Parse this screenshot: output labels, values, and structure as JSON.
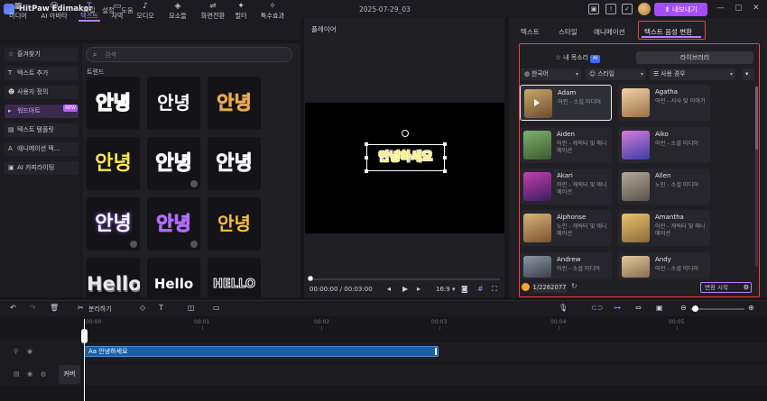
{
  "titlebar": {
    "app_name": "HitPaw Edimakor",
    "menus": [
      "파일",
      "설정",
      "도움"
    ],
    "document_title": "2025-07-29_03",
    "export_label": "내보내기"
  },
  "media_tabs": [
    {
      "label": "미디어",
      "icon": "media-icon"
    },
    {
      "label": "AI 아바타",
      "icon": "ai-avatar-icon"
    },
    {
      "label": "텍스트",
      "icon": "text-icon",
      "active": true
    },
    {
      "label": "자막",
      "icon": "subtitle-icon"
    },
    {
      "label": "오디오",
      "icon": "audio-icon"
    },
    {
      "label": "요소들",
      "icon": "elements-icon"
    },
    {
      "label": "화면전환",
      "icon": "transition-icon"
    },
    {
      "label": "필터",
      "icon": "filter-icon"
    },
    {
      "label": "특수효과",
      "icon": "effects-icon"
    }
  ],
  "sidebar": {
    "items": [
      {
        "label": "즐겨찾기",
        "icon": "star-icon"
      },
      {
        "label": "텍스트 추가",
        "icon": "text-add-icon"
      },
      {
        "label": "사용자 정의",
        "icon": "user-icon"
      },
      {
        "label": "워드아트",
        "icon": "wordart-icon",
        "badge": "NEW",
        "active": true
      },
      {
        "label": "텍스트 템플릿",
        "icon": "template-icon"
      },
      {
        "label": "애니메이션 텍...",
        "icon": "animation-text-icon"
      },
      {
        "label": "AI 카피라이팅",
        "icon": "ai-copy-icon"
      }
    ]
  },
  "text_panel": {
    "search_placeholder": "검색",
    "section_label": "트렌드",
    "tiles": [
      {
        "text": "안녕"
      },
      {
        "text": "안녕"
      },
      {
        "text": "안녕"
      },
      {
        "text": "안녕"
      },
      {
        "text": "안녕"
      },
      {
        "text": "안녕"
      },
      {
        "text": "안녕"
      },
      {
        "text": "안녕"
      },
      {
        "text": "안녕"
      },
      {
        "text": "Hello"
      },
      {
        "text": "Hello"
      },
      {
        "text": "HELLO"
      }
    ]
  },
  "player": {
    "title": "플레이어",
    "stage_text": "안녕하세요",
    "current_time": "00:00:00",
    "total_time": "00:03:00",
    "aspect_ratio": "16:9"
  },
  "right_panel": {
    "tabs": [
      "텍스트",
      "스타일",
      "애니메이션",
      "텍스트 음성 변환"
    ],
    "active_tab": "텍스트 음성 변환",
    "subtabs": {
      "my_voice": "내 목소리",
      "ai_badge": "AI",
      "library": "라이브러리"
    },
    "filters": [
      "한국어",
      "스타일",
      "사용 경우"
    ],
    "voices": [
      {
        "name": "Adam",
        "desc": "어린 - 소설 미디어",
        "selected": true
      },
      {
        "name": "Agatha",
        "desc": "어린 - 서사 및 이야기"
      },
      {
        "name": "Aiden",
        "desc": "어린 - 캐릭터 및 애니메이션"
      },
      {
        "name": "Aiko",
        "desc": "어린 - 소셜 미디어"
      },
      {
        "name": "Akari",
        "desc": "어린 - 캐릭터 및 애니메이션"
      },
      {
        "name": "Allen",
        "desc": "노인 - 소셜 미디어"
      },
      {
        "name": "Alphonse",
        "desc": "노인 - 캐릭터 및 애니메이션"
      },
      {
        "name": "Amantha",
        "desc": "어린 - 캐릭터 및 애니메이션"
      },
      {
        "name": "Andrew",
        "desc": "어린 - 소셜 미디어"
      },
      {
        "name": "Andy",
        "desc": "어린 - 소셜 미디어"
      }
    ],
    "credits": "1/2262077",
    "start_label": "변환 시작"
  },
  "timeline": {
    "split_label": "분리하기",
    "ruler_ticks": [
      "00:00",
      "00:01",
      "00:02",
      "00:03",
      "00:04",
      "00:05"
    ],
    "clip_label": "Aa 안녕하세요",
    "cover_label": "커버"
  }
}
